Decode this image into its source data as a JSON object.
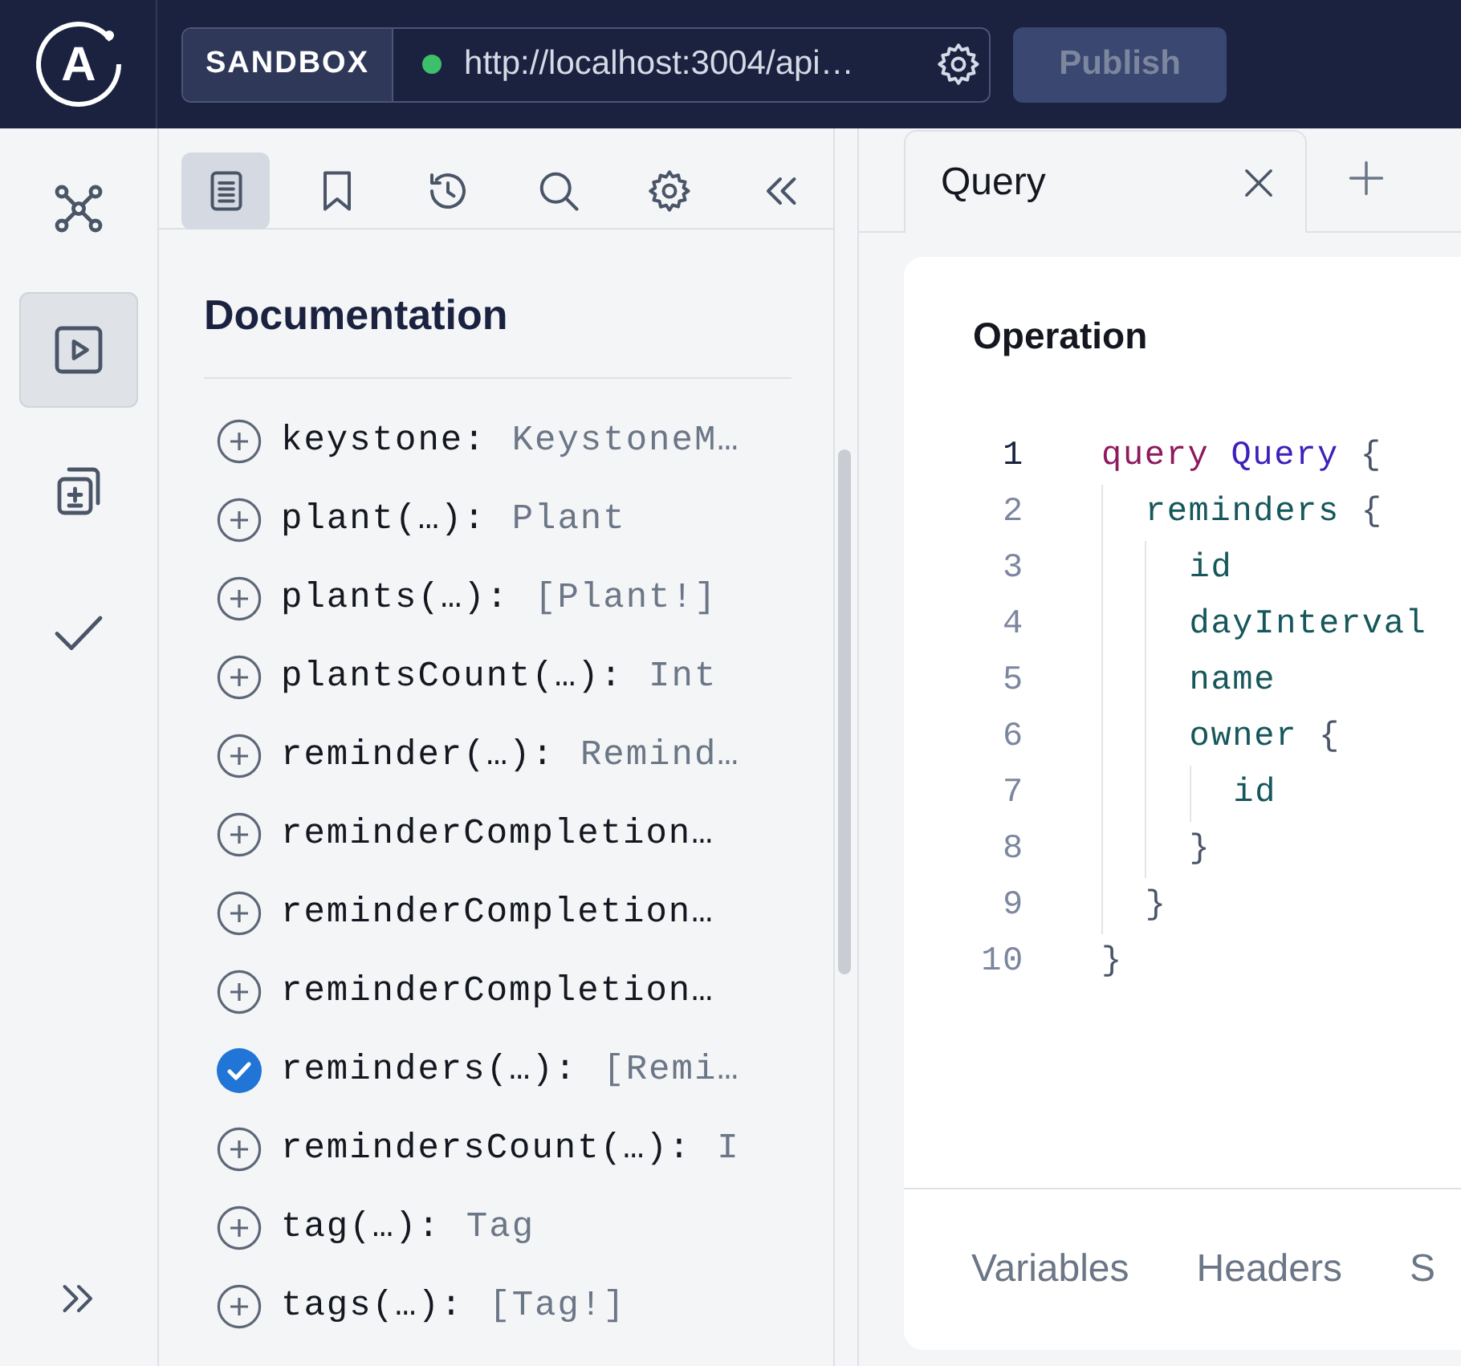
{
  "topbar": {
    "logo": "A",
    "environment": "SANDBOX",
    "endpoint": {
      "url": "http://localhost:3004/api…",
      "connected": true
    },
    "publish": {
      "label": "Publish",
      "disabled": true
    }
  },
  "rail": {
    "items": [
      {
        "selected": false
      },
      {
        "selected": true
      },
      {
        "selected": false
      },
      {
        "selected": false
      }
    ]
  },
  "docs": {
    "toolbar": [
      {
        "selected": true
      },
      {
        "selected": false
      },
      {
        "selected": false
      },
      {
        "selected": false
      },
      {
        "selected": false
      },
      {
        "selected": false
      }
    ],
    "title": "Documentation",
    "fields": [
      {
        "field": "keystone:",
        "type": "KeystoneM…",
        "included": false
      },
      {
        "field": "plant(…):",
        "type": "Plant",
        "included": false
      },
      {
        "field": "plants(…):",
        "type": "[Plant!]",
        "included": false
      },
      {
        "field": "plantsCount(…):",
        "type": "Int",
        "included": false
      },
      {
        "field": "reminder(…):",
        "type": "Remind…",
        "included": false
      },
      {
        "field": "reminderCompletion…",
        "included": false
      },
      {
        "field": "reminderCompletion…",
        "included": false
      },
      {
        "field": "reminderCompletion…",
        "included": false
      },
      {
        "field": "reminders(…):",
        "type": "[Remi…",
        "included": true
      },
      {
        "field": "remindersCount(…):",
        "type": "I",
        "included": false
      },
      {
        "field": "tag(…):",
        "type": "Tag",
        "included": false
      },
      {
        "field": "tags(…):",
        "type": "[Tag!]",
        "included": false
      }
    ]
  },
  "editor": {
    "tabs": [
      {
        "label": "Query",
        "selected": true
      }
    ],
    "title": "Operation",
    "lines": [
      {
        "number": "1",
        "current": true,
        "tokens": [
          {
            "kind": "keyword",
            "text": "query"
          },
          {
            "kind": "name",
            "text": " Query"
          },
          {
            "kind": "punct",
            "text": " {"
          }
        ],
        "children": [
          {
            "number": "2",
            "current": false,
            "tokens": [
              {
                "kind": "field",
                "text": "reminders"
              },
              {
                "kind": "punct",
                "text": " {"
              }
            ],
            "children": [
              {
                "number": "3",
                "current": false,
                "tokens": [
                  {
                    "kind": "field",
                    "text": "id"
                  }
                ]
              },
              {
                "number": "4",
                "current": false,
                "tokens": [
                  {
                    "kind": "field",
                    "text": "dayInterval"
                  }
                ]
              },
              {
                "number": "5",
                "current": false,
                "tokens": [
                  {
                    "kind": "field",
                    "text": "name"
                  }
                ]
              },
              {
                "number": "6",
                "current": false,
                "tokens": [
                  {
                    "kind": "field",
                    "text": "owner"
                  },
                  {
                    "kind": "punct",
                    "text": " {"
                  }
                ],
                "children": [
                  {
                    "number": "7",
                    "current": false,
                    "tokens": [
                      {
                        "kind": "field",
                        "text": "id"
                      }
                    ]
                  }
                ]
              },
              {
                "number": "8",
                "current": false,
                "tokens": [
                  {
                    "kind": "punct",
                    "text": "}"
                  }
                ]
              }
            ]
          },
          {
            "number": "9",
            "current": false,
            "tokens": [
              {
                "kind": "punct",
                "text": "}"
              }
            ]
          }
        ]
      },
      {
        "number": "10",
        "current": false,
        "tokens": [
          {
            "kind": "punct",
            "text": "}"
          }
        ]
      }
    ],
    "bottom_tabs": [
      {
        "label": "Variables"
      },
      {
        "label": "Headers"
      },
      {
        "label": "S"
      }
    ]
  }
}
